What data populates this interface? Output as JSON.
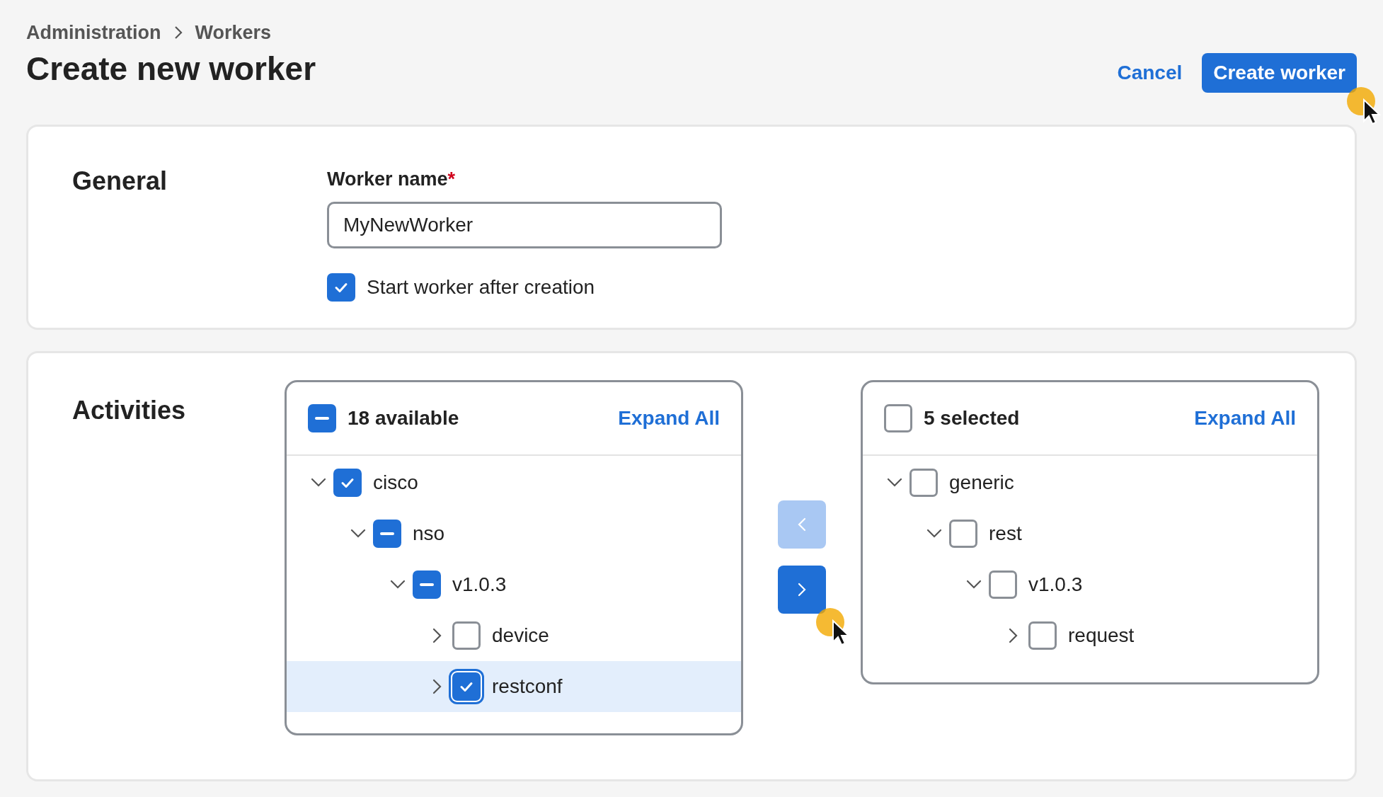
{
  "breadcrumb": [
    {
      "label": "Administration"
    },
    {
      "label": "Workers"
    }
  ],
  "title": "Create new worker",
  "actions": {
    "cancel": "Cancel",
    "create": "Create worker"
  },
  "general": {
    "heading": "General",
    "field": {
      "label": "Worker name",
      "required_mark": "*",
      "value": "MyNewWorker"
    },
    "start_after": {
      "label": "Start worker after creation",
      "checked": true
    }
  },
  "activities": {
    "heading": "Activities",
    "available": {
      "checked": true,
      "indeterminate": true,
      "count": "18 available",
      "expand_all": "Expand All",
      "tree": [
        {
          "label": "cisco",
          "expanded": true,
          "checked": true,
          "indeterminate": false,
          "selected": false,
          "children": [
            {
              "label": "nso",
              "expanded": true,
              "checked": true,
              "indeterminate": true,
              "selected": false,
              "children": [
                {
                  "label": "v1.0.3",
                  "expanded": true,
                  "checked": true,
                  "indeterminate": true,
                  "selected": false,
                  "children": [
                    {
                      "label": "device",
                      "expanded": false,
                      "checked": false,
                      "indeterminate": false,
                      "selected": false
                    },
                    {
                      "label": "restconf",
                      "expanded": false,
                      "checked": true,
                      "indeterminate": false,
                      "selected": true
                    }
                  ]
                }
              ]
            }
          ]
        }
      ]
    },
    "transfer": [
      {
        "kind": "back",
        "disabled": true
      },
      {
        "kind": "forward",
        "disabled": false
      }
    ],
    "selected": {
      "checked": false,
      "indeterminate": false,
      "count": "5 selected",
      "expand_all": "Expand All",
      "tree": [
        {
          "label": "generic",
          "expanded": true,
          "checked": false,
          "indeterminate": false,
          "selected": false,
          "children": [
            {
              "label": "rest",
              "expanded": true,
              "checked": false,
              "indeterminate": false,
              "selected": false,
              "children": [
                {
                  "label": "v1.0.3",
                  "expanded": true,
                  "checked": false,
                  "indeterminate": false,
                  "selected": false,
                  "children": [
                    {
                      "label": "request",
                      "expanded": false,
                      "checked": false,
                      "indeterminate": false,
                      "selected": false
                    }
                  ]
                }
              ]
            }
          ]
        }
      ]
    }
  }
}
